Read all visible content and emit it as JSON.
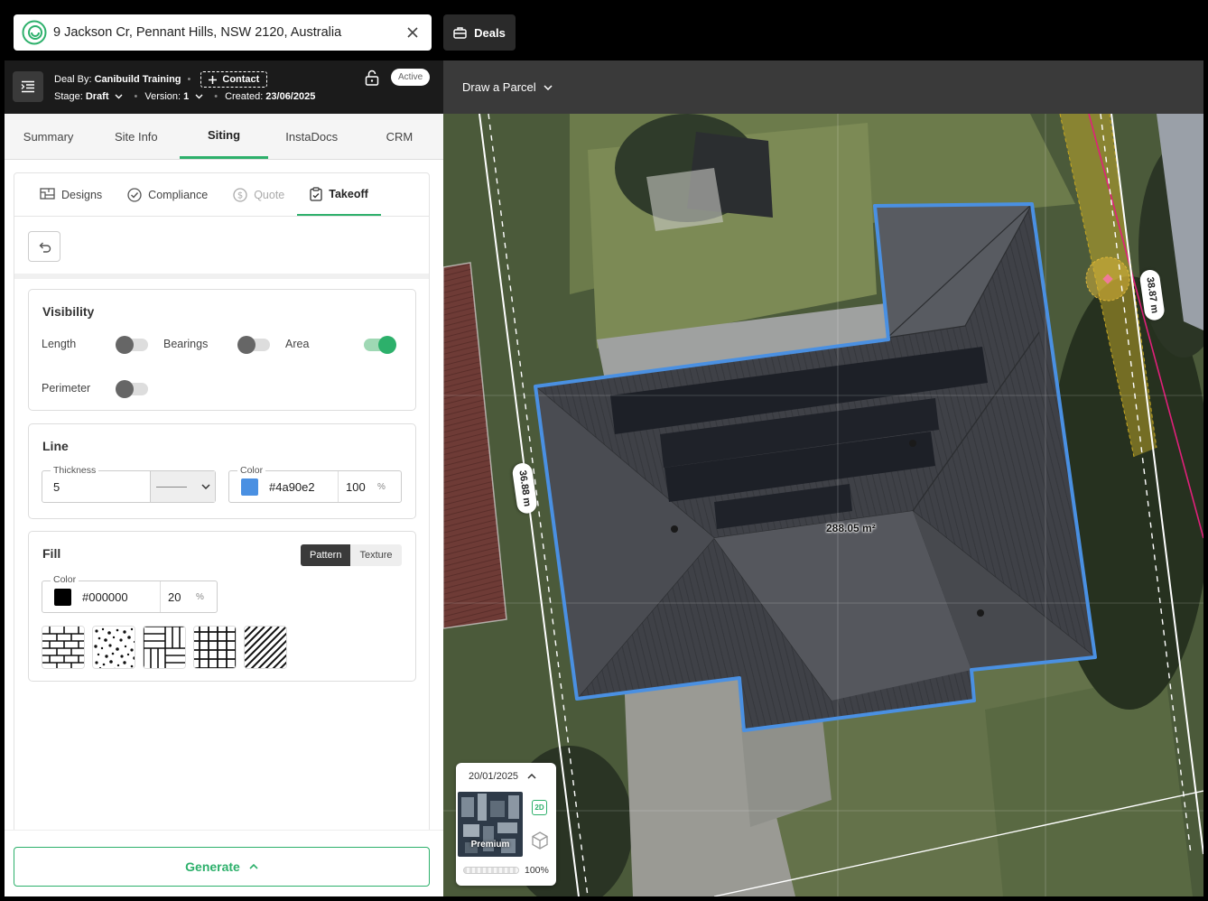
{
  "search": {
    "address": "9 Jackson Cr, Pennant Hills, NSW 2120, Australia"
  },
  "topbar": {
    "deals_label": "Deals"
  },
  "deal": {
    "by_label": "Deal By:",
    "by_value": "Canibuild Training",
    "contact_label": "Contact",
    "stage_label": "Stage:",
    "stage_value": "Draft",
    "version_label": "Version:",
    "version_value": "1",
    "created_label": "Created:",
    "created_value": "23/06/2025",
    "status": "Active"
  },
  "tabs": [
    {
      "label": "Summary"
    },
    {
      "label": "Site Info"
    },
    {
      "label": "Siting",
      "active": true
    },
    {
      "label": "InstaDocs"
    },
    {
      "label": "CRM"
    }
  ],
  "subtabs": [
    {
      "label": "Designs",
      "icon": "designs-icon"
    },
    {
      "label": "Compliance",
      "icon": "compliance-icon"
    },
    {
      "label": "Quote",
      "icon": "quote-icon",
      "disabled": true
    },
    {
      "label": "Takeoff",
      "icon": "takeoff-icon",
      "active": true
    }
  ],
  "visibility": {
    "title": "Visibility",
    "length_label": "Length",
    "length_on": false,
    "bearings_label": "Bearings",
    "bearings_on": false,
    "area_label": "Area",
    "area_on": true,
    "perimeter_label": "Perimeter",
    "perimeter_on": false
  },
  "line": {
    "title": "Line",
    "thickness_label": "Thickness",
    "thickness_value": "5",
    "color_label": "Color",
    "color_value": "#4a90e2",
    "opacity_value": "100",
    "percent": "%"
  },
  "fill": {
    "title": "Fill",
    "mode_pattern": "Pattern",
    "mode_texture": "Texture",
    "color_label": "Color",
    "color_value": "#000000",
    "opacity_value": "20",
    "percent": "%",
    "patterns": [
      "brick-pattern",
      "gravel-pattern",
      "parquet-pattern",
      "grid-pattern",
      "diagonal-pattern"
    ]
  },
  "generate_label": "Generate",
  "map": {
    "parcel_label": "Draw a Parcel",
    "left_dimension": "36.88 m",
    "right_dimension": "38.87 m",
    "area_label": "288.05 m²",
    "imagery": {
      "date": "20/01/2025",
      "thumb_label": "Premium",
      "mode_2d": "2D",
      "opacity": "100%",
      "opacity_fraction": 1.0
    }
  },
  "colors": {
    "accent": "#2db06b",
    "outline": "#4a90e2",
    "boundary_magenta": "#e0207a"
  }
}
